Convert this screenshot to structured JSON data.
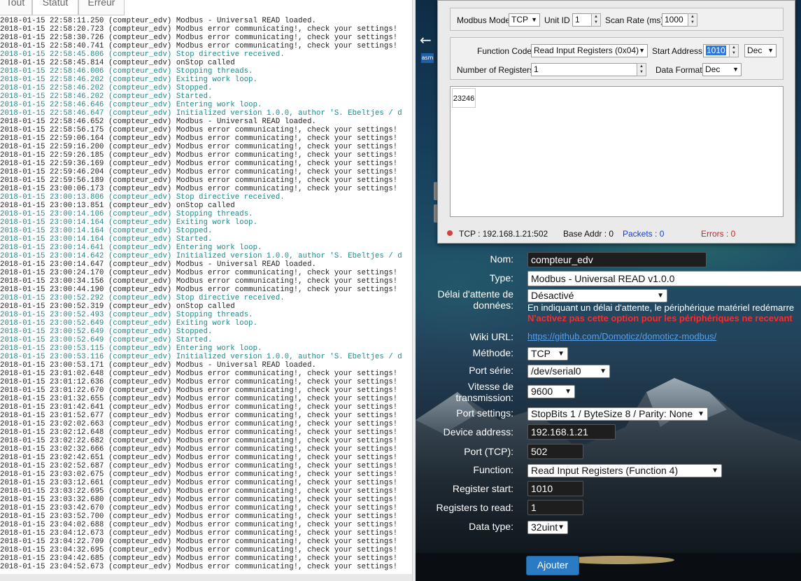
{
  "log_tabs": [
    "Tout",
    "Statut",
    "Erreur"
  ],
  "log_lines": [
    {
      "t": "2018-01-15 22:58:11.250 (compteur_edv) Modbus - Universal READ loaded.",
      "s": false
    },
    {
      "t": "2018-01-15 22:58:20.723 (compteur_edv) Modbus error communicating!, check your settings!",
      "s": false
    },
    {
      "t": "2018-01-15 22:58:30.726 (compteur_edv) Modbus error communicating!, check your settings!",
      "s": false
    },
    {
      "t": "2018-01-15 22:58:40.741 (compteur_edv) Modbus error communicating!, check your settings!",
      "s": false
    },
    {
      "t": "2018-01-15 22:58:45.806 (compteur_edv) Stop directive received.",
      "s": true
    },
    {
      "t": "2018-01-15 22:58:45.814 (compteur_edv) onStop called",
      "s": false
    },
    {
      "t": "2018-01-15 22:58:46.006 (compteur_edv) Stopping threads.",
      "s": true
    },
    {
      "t": "2018-01-15 22:58:46.202 (compteur_edv) Exiting work loop.",
      "s": true
    },
    {
      "t": "2018-01-15 22:58:46.202 (compteur_edv) Stopped.",
      "s": true
    },
    {
      "t": "2018-01-15 22:58:46.202 (compteur_edv) Started.",
      "s": true
    },
    {
      "t": "2018-01-15 22:58:46.646 (compteur_edv) Entering work loop.",
      "s": true
    },
    {
      "t": "2018-01-15 22:58:46.647 (compteur_edv) Initialized version 1.0.0, author 'S. Ebeltjes / d",
      "s": true
    },
    {
      "t": "2018-01-15 22:58:46.652 (compteur_edv) Modbus - Universal READ loaded.",
      "s": false
    },
    {
      "t": "2018-01-15 22:58:56.175 (compteur_edv) Modbus error communicating!, check your settings!",
      "s": false
    },
    {
      "t": "2018-01-15 22:59:06.164 (compteur_edv) Modbus error communicating!, check your settings!",
      "s": false
    },
    {
      "t": "2018-01-15 22:59:16.200 (compteur_edv) Modbus error communicating!, check your settings!",
      "s": false
    },
    {
      "t": "2018-01-15 22:59:26.185 (compteur_edv) Modbus error communicating!, check your settings!",
      "s": false
    },
    {
      "t": "2018-01-15 22:59:36.169 (compteur_edv) Modbus error communicating!, check your settings!",
      "s": false
    },
    {
      "t": "2018-01-15 22:59:46.204 (compteur_edv) Modbus error communicating!, check your settings!",
      "s": false
    },
    {
      "t": "2018-01-15 22:59:56.189 (compteur_edv) Modbus error communicating!, check your settings!",
      "s": false
    },
    {
      "t": "2018-01-15 23:00:06.173 (compteur_edv) Modbus error communicating!, check your settings!",
      "s": false
    },
    {
      "t": "2018-01-15 23:00:13.806 (compteur_edv) Stop directive received.",
      "s": true
    },
    {
      "t": "2018-01-15 23:00:13.851 (compteur_edv) onStop called",
      "s": false
    },
    {
      "t": "2018-01-15 23:00:14.106 (compteur_edv) Stopping threads.",
      "s": true
    },
    {
      "t": "2018-01-15 23:00:14.164 (compteur_edv) Exiting work loop.",
      "s": true
    },
    {
      "t": "2018-01-15 23:00:14.164 (compteur_edv) Stopped.",
      "s": true
    },
    {
      "t": "2018-01-15 23:00:14.164 (compteur_edv) Started.",
      "s": true
    },
    {
      "t": "2018-01-15 23:00:14.641 (compteur_edv) Entering work loop.",
      "s": true
    },
    {
      "t": "2018-01-15 23:00:14.642 (compteur_edv) Initialized version 1.0.0, author 'S. Ebeltjes / d",
      "s": true
    },
    {
      "t": "2018-01-15 23:00:14.647 (compteur_edv) Modbus - Universal READ loaded.",
      "s": false
    },
    {
      "t": "2018-01-15 23:00:24.170 (compteur_edv) Modbus error communicating!, check your settings!",
      "s": false
    },
    {
      "t": "2018-01-15 23:00:34.156 (compteur_edv) Modbus error communicating!, check your settings!",
      "s": false
    },
    {
      "t": "2018-01-15 23:00:44.190 (compteur_edv) Modbus error communicating!, check your settings!",
      "s": false
    },
    {
      "t": "2018-01-15 23:00:52.292 (compteur_edv) Stop directive received.",
      "s": true
    },
    {
      "t": "2018-01-15 23:00:52.319 (compteur_edv) onStop called",
      "s": false
    },
    {
      "t": "2018-01-15 23:00:52.493 (compteur_edv) Stopping threads.",
      "s": true
    },
    {
      "t": "2018-01-15 23:00:52.649 (compteur_edv) Exiting work loop.",
      "s": true
    },
    {
      "t": "2018-01-15 23:00:52.649 (compteur_edv) Stopped.",
      "s": true
    },
    {
      "t": "2018-01-15 23:00:52.649 (compteur_edv) Started.",
      "s": true
    },
    {
      "t": "2018-01-15 23:00:53.115 (compteur_edv) Entering work loop.",
      "s": true
    },
    {
      "t": "2018-01-15 23:00:53.116 (compteur_edv) Initialized version 1.0.0, author 'S. Ebeltjes / d",
      "s": true
    },
    {
      "t": "2018-01-15 23:00:53.171 (compteur_edv) Modbus - Universal READ loaded.",
      "s": false
    },
    {
      "t": "2018-01-15 23:01:02.648 (compteur_edv) Modbus error communicating!, check your settings!",
      "s": false
    },
    {
      "t": "2018-01-15 23:01:12.636 (compteur_edv) Modbus error communicating!, check your settings!",
      "s": false
    },
    {
      "t": "2018-01-15 23:01:22.670 (compteur_edv) Modbus error communicating!, check your settings!",
      "s": false
    },
    {
      "t": "2018-01-15 23:01:32.655 (compteur_edv) Modbus error communicating!, check your settings!",
      "s": false
    },
    {
      "t": "2018-01-15 23:01:42.641 (compteur_edv) Modbus error communicating!, check your settings!",
      "s": false
    },
    {
      "t": "2018-01-15 23:01:52.677 (compteur_edv) Modbus error communicating!, check your settings!",
      "s": false
    },
    {
      "t": "2018-01-15 23:02:02.663 (compteur_edv) Modbus error communicating!, check your settings!",
      "s": false
    },
    {
      "t": "2018-01-15 23:02:12.648 (compteur_edv) Modbus error communicating!, check your settings!",
      "s": false
    },
    {
      "t": "2018-01-15 23:02:22.682 (compteur_edv) Modbus error communicating!, check your settings!",
      "s": false
    },
    {
      "t": "2018-01-15 23:02:32.666 (compteur_edv) Modbus error communicating!, check your settings!",
      "s": false
    },
    {
      "t": "2018-01-15 23:02:42.651 (compteur_edv) Modbus error communicating!, check your settings!",
      "s": false
    },
    {
      "t": "2018-01-15 23:02:52.687 (compteur_edv) Modbus error communicating!, check your settings!",
      "s": false
    },
    {
      "t": "2018-01-15 23:03:02.675 (compteur_edv) Modbus error communicating!, check your settings!",
      "s": false
    },
    {
      "t": "2018-01-15 23:03:12.661 (compteur_edv) Modbus error communicating!, check your settings!",
      "s": false
    },
    {
      "t": "2018-01-15 23:03:22.695 (compteur_edv) Modbus error communicating!, check your settings!",
      "s": false
    },
    {
      "t": "2018-01-15 23:03:32.680 (compteur_edv) Modbus error communicating!, check your settings!",
      "s": false
    },
    {
      "t": "2018-01-15 23:03:42.670 (compteur_edv) Modbus error communicating!, check your settings!",
      "s": false
    },
    {
      "t": "2018-01-15 23:03:52.700 (compteur_edv) Modbus error communicating!, check your settings!",
      "s": false
    },
    {
      "t": "2018-01-15 23:04:02.688 (compteur_edv) Modbus error communicating!, check your settings!",
      "s": false
    },
    {
      "t": "2018-01-15 23:04:12.673 (compteur_edv) Modbus error communicating!, check your settings!",
      "s": false
    },
    {
      "t": "2018-01-15 23:04:22.709 (compteur_edv) Modbus error communicating!, check your settings!",
      "s": false
    },
    {
      "t": "2018-01-15 23:04:32.695 (compteur_edv) Modbus error communicating!, check your settings!",
      "s": false
    },
    {
      "t": "2018-01-15 23:04:42.685 (compteur_edv) Modbus error communicating!, check your settings!",
      "s": false
    },
    {
      "t": "2018-01-15 23:04:52.673 (compteur_edv) Modbus error communicating!, check your settings!",
      "s": false
    }
  ],
  "modbus_tool": {
    "mode_label": "Modbus Mode",
    "mode_value": "TCP",
    "unit_id_label": "Unit ID",
    "unit_id_value": "1",
    "scan_rate_label": "Scan Rate (ms)",
    "scan_rate_value": "1000",
    "function_code_label": "Function Code",
    "function_code_value": "Read Input Registers (0x04)",
    "start_address_label": "Start Address",
    "start_address_value": "1010",
    "start_address_format": "Dec",
    "num_registers_label": "Number of Registers",
    "num_registers_value": "1",
    "data_format_label": "Data Format",
    "data_format_value": "Dec",
    "output_value": "23246",
    "status_connection": "TCP : 192.168.1.21:502",
    "status_base_addr": "Base Addr : 0",
    "status_packets": "Packets : 0",
    "status_errors": "Errors : 0"
  },
  "nav": {
    "logo_text": "asm"
  },
  "form": {
    "name_label": "Nom:",
    "name_value": "compteur_edv",
    "type_label": "Type:",
    "type_value": "Modbus - Universal READ v1.0.0",
    "timeout_label": "Délai d'attente de données:",
    "timeout_value": "Désactivé",
    "timeout_info": "En indiquant un délai d'attente, le périphérique matériel redémarre",
    "timeout_warning": "N'activez pas cette option pour les périphériques ne recevant",
    "wiki_label": "Wiki URL:",
    "wiki_link": "https://github.com/Domoticz/domoticz-modbus/",
    "method_label": "Méthode:",
    "method_value": "TCP",
    "serial_port_label": "Port série:",
    "serial_port_value": "/dev/serial0",
    "baud_label": "Vitesse de transmission:",
    "baud_value": "9600",
    "port_settings_label": "Port settings:",
    "port_settings_value": "StopBits 1 / ByteSize 8 / Parity: None",
    "device_address_label": "Device address:",
    "device_address_value": "192.168.1.21",
    "port_tcp_label": "Port (TCP):",
    "port_tcp_value": "502",
    "function_label": "Function:",
    "function_value": "Read Input Registers (Function 4)",
    "register_start_label": "Register start:",
    "register_start_value": "1010",
    "registers_to_read_label": "Registers to read:",
    "registers_to_read_value": "1",
    "data_type_label": "Data type:",
    "data_type_value": "32uint",
    "add_button": "Ajouter"
  },
  "colors": {
    "status_line": "#1a8a8a",
    "link": "#5aa0e6",
    "warning": "#ff2a2a",
    "packets": "#1a3fd0",
    "errors": "#d02020",
    "button": "#2a7bc4"
  }
}
